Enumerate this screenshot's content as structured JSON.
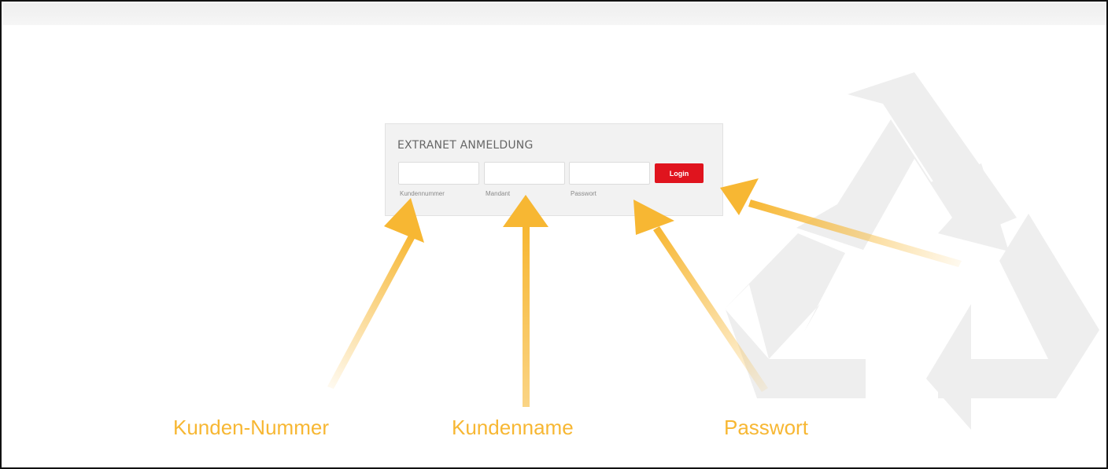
{
  "login": {
    "title": "EXTRANET ANMELDUNG",
    "fields": [
      {
        "label": "Kundennummer",
        "value": ""
      },
      {
        "label": "Mandant",
        "value": ""
      },
      {
        "label": "Passwort",
        "value": ""
      }
    ],
    "button_label": "Login"
  },
  "annotations": {
    "customer_number": "Kunden-Nummer",
    "customer_name": "Kundenname",
    "password": "Passwort"
  },
  "colors": {
    "arrow": "#f7b733",
    "button": "#e0141e",
    "watermark": "#eeeeee"
  },
  "icons": {
    "watermark": "recycle-icon",
    "arrows": "arrow-up-icon"
  }
}
